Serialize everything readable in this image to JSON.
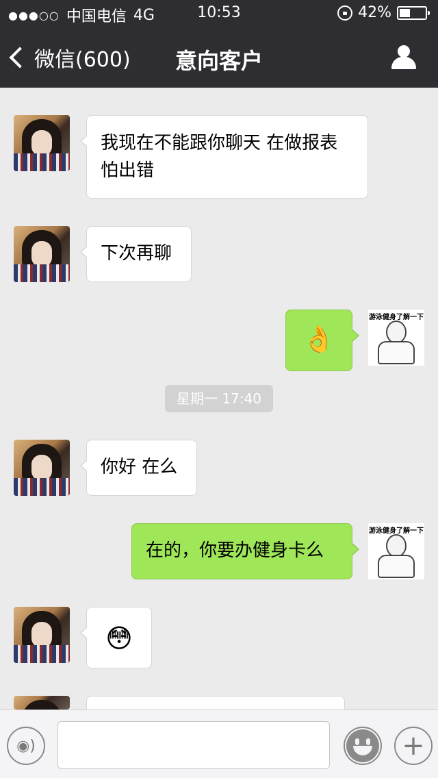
{
  "status_bar": {
    "signal": "●●●○○",
    "carrier": "中国电信",
    "network": "4G",
    "time": "10:53",
    "battery": "42%",
    "battery_level": 0.42
  },
  "nav": {
    "back_label": "微信(600)",
    "title": "意向客户"
  },
  "messages": [
    {
      "side": "in",
      "text": "我现在不能跟你聊天 在做报表 怕出错"
    },
    {
      "side": "in",
      "text": "下次再聊"
    },
    {
      "side": "out",
      "emoji": "👌"
    },
    {
      "side": "in",
      "text": "你好 在么"
    },
    {
      "side": "out",
      "text": "在的，你要办健身卡么"
    },
    {
      "side": "in",
      "emoji": "😳"
    }
  ],
  "timestamp": "星期一 17:40",
  "sender_avatar_caption": "游泳健身了解一下",
  "input": {
    "placeholder": ""
  },
  "colors": {
    "bar": "#2e2e32",
    "outgoing": "#9fe658",
    "incoming": "#ffffff",
    "background": "#ebebeb"
  }
}
